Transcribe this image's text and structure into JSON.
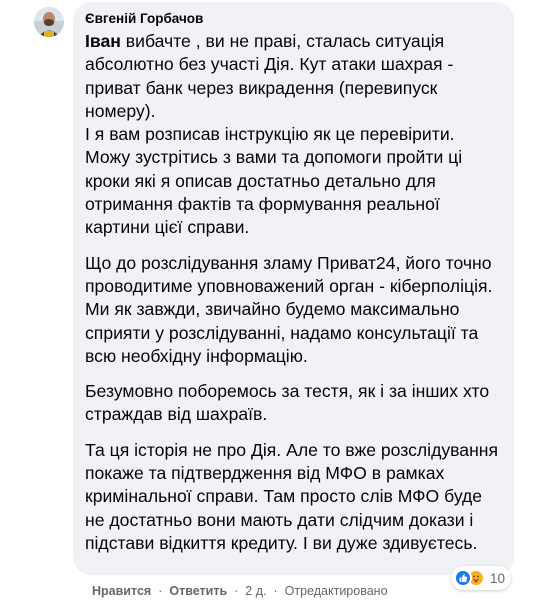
{
  "comment": {
    "author": "Євгеній Горбачов",
    "mention": "Іван",
    "paragraphs": [
      " вибачте , ви не праві, сталась ситуація абсолютно без участі Дія. Кут атаки шахрая - приват банк через викрадення (перевипуск номеру).",
      "І я вам розписав інструкцію як це перевірити. Можу зустрітись з вами та допомоги пройти ці кроки які я описав достатньо детально для отримання фактів та формування реальної картини цієї справи.",
      "Що до розслідування зламу Приват24, його точно проводитиме уповноважений орган - кіберполіція. Ми як завжди, звичайно будемо максимально сприяти у розслідуванні, надамо консультації та всю необхідну інформацію.",
      "Безумовно поборемось за тестя, як і за інших хто страждав від шахраїв.",
      "Та ця історія не про Дія. Але то вже розслідування покаже та підтвердження від МФО в рамках кримінальної справи. Там просто слів МФО буде не достатньо вони мають дати слідчим докази і підстави відкиття кредиту. І ви дуже здивуєтесь."
    ],
    "reactions": {
      "count": "10",
      "icons": [
        "like-icon",
        "care-icon"
      ]
    }
  },
  "actions": {
    "like": "Нравится",
    "reply": "Ответить",
    "time": "2 д.",
    "edited": "Отредактировано",
    "separator": "·"
  },
  "colors": {
    "bubble": "#f0f2f5",
    "meta_text": "#65676b",
    "like_blue": "#1877f2",
    "care_yellow": "#f7b125"
  }
}
